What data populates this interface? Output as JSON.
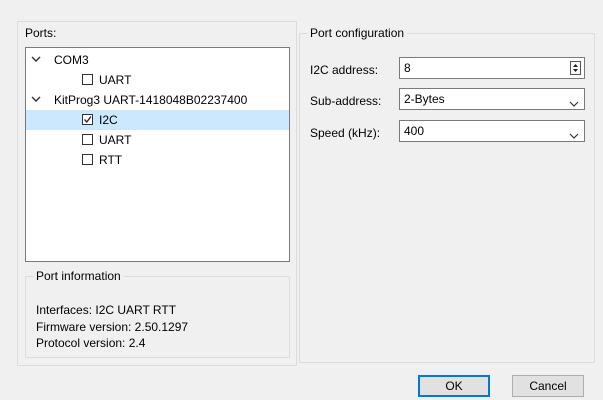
{
  "ports": {
    "label": "Ports:",
    "tree": [
      {
        "label": "COM3",
        "children": [
          {
            "label": "UART",
            "checked": false
          }
        ]
      },
      {
        "label": "KitProg3 UART-1418048B02237400",
        "children": [
          {
            "label": "I2C",
            "checked": true,
            "selected": true
          },
          {
            "label": "UART",
            "checked": false
          },
          {
            "label": "RTT",
            "checked": false
          }
        ]
      }
    ]
  },
  "port_information": {
    "title": "Port information",
    "interfaces": "Interfaces: I2C UART RTT",
    "firmware": "Firmware version: 2.50.1297",
    "protocol": "Protocol version: 2.4"
  },
  "port_configuration": {
    "title": "Port configuration",
    "i2c_address": {
      "label": "I2C address:",
      "value": "8"
    },
    "sub_address": {
      "label": "Sub-address:",
      "value": "2-Bytes"
    },
    "speed": {
      "label": "Speed (kHz):",
      "value": "400"
    }
  },
  "buttons": {
    "ok": "OK",
    "cancel": "Cancel"
  },
  "colors": {
    "selection": "#cce8ff",
    "accent": "#0078d7"
  }
}
